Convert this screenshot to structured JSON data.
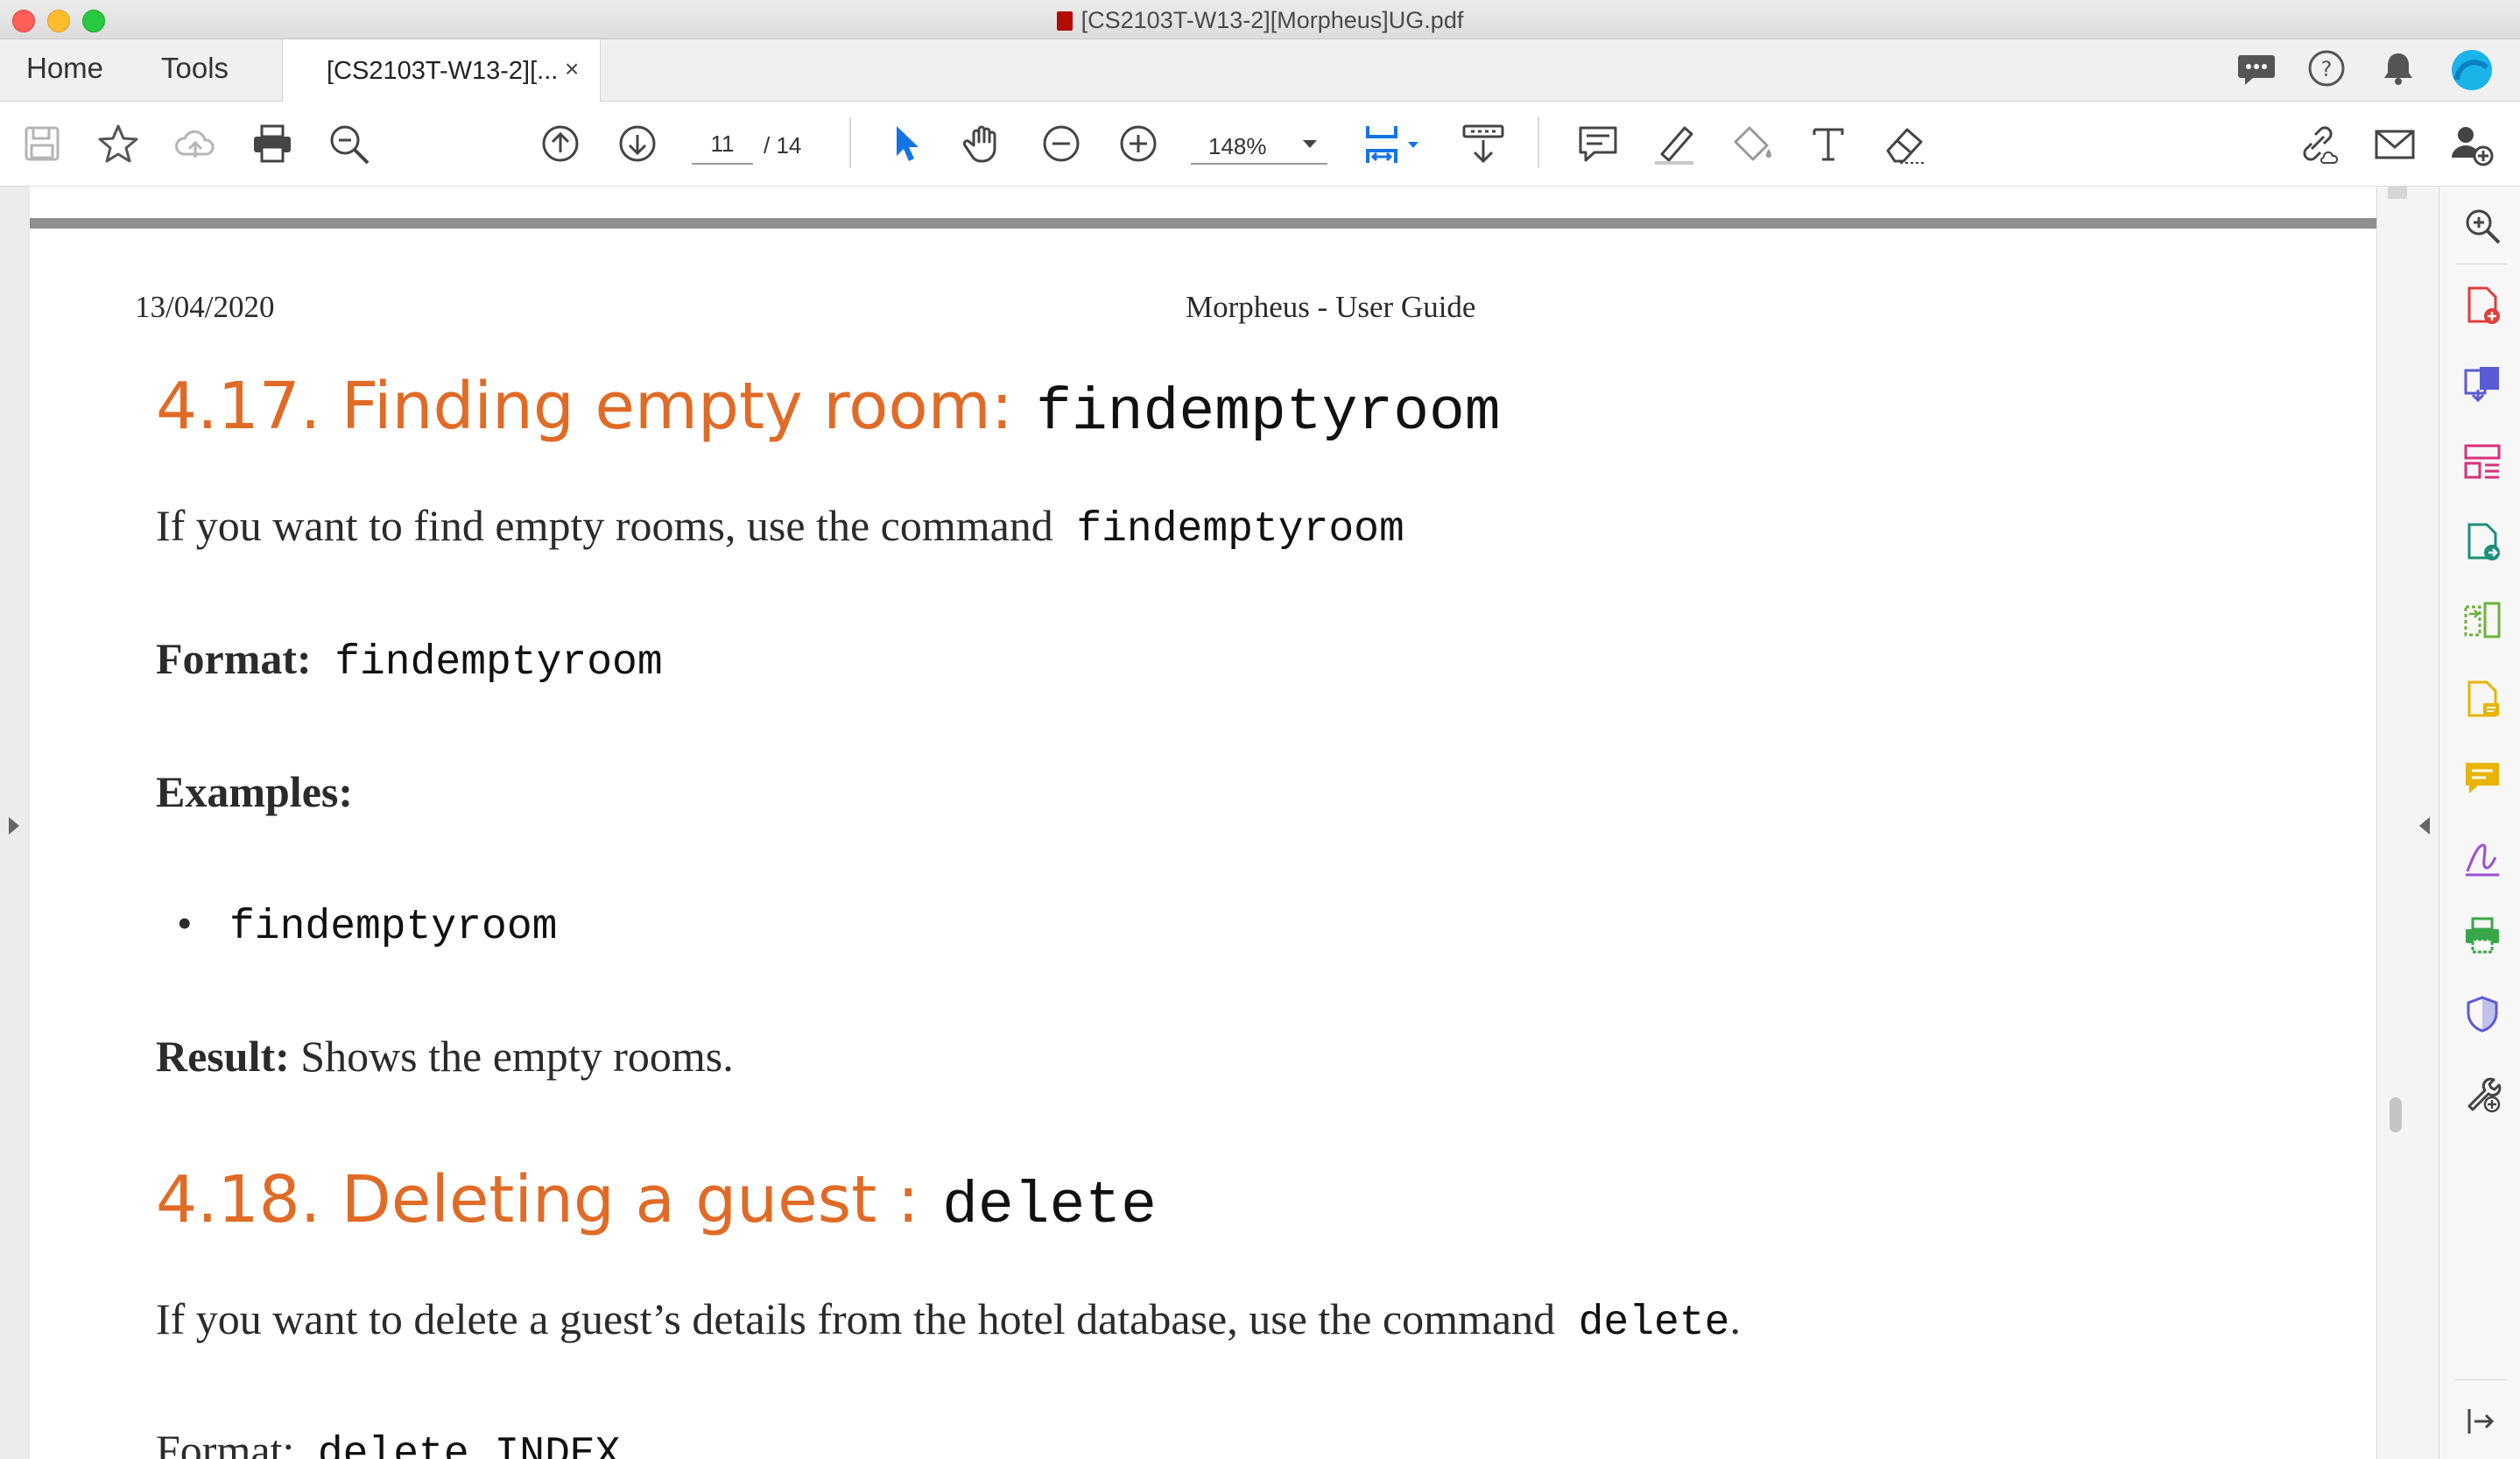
{
  "window": {
    "title": "[CS2103T-W13-2][Morpheus]UG.pdf"
  },
  "tabs": {
    "home": "Home",
    "tools": "Tools",
    "document": "[CS2103T-W13-2][...",
    "close_glyph": "×"
  },
  "toolbar": {
    "page_current": "11",
    "page_total": "/ 14",
    "zoom": "148%"
  },
  "document": {
    "header_date": "13/04/2020",
    "header_title": "Morpheus - User Guide",
    "section_417": {
      "title": "4.17. Finding empty room:",
      "command": "findemptyroom",
      "intro": "If you want to find empty rooms, use the command",
      "intro_cmd": "findemptyroom",
      "format_label": "Format:",
      "format_cmd": "findemptyroom",
      "examples_label": "Examples:",
      "example_bullet": "•",
      "example_1": "findemptyroom",
      "result_label": "Result:",
      "result_text": "Shows the empty rooms."
    },
    "section_418": {
      "title": "4.18. Deleting a guest :",
      "command": "delete",
      "intro": "If you want to delete a guest’s details from the hotel database, use the command",
      "intro_cmd": "delete",
      "intro_end": ".",
      "format_label": "Format:",
      "format_cmd": "delete INDEX"
    }
  },
  "colors": {
    "heading": "#e06b26",
    "accent_blue": "#1473e6"
  },
  "icons": {
    "right_panel": [
      "search-icon",
      "create-pdf-icon",
      "export-pdf-icon",
      "organize-pages-icon",
      "edit-pdf-icon",
      "compare-icon",
      "fill-sign-icon",
      "comment-icon",
      "sign-icon",
      "print-production-icon",
      "protect-icon",
      "more-tools-icon",
      "collapse-panel-icon"
    ]
  }
}
